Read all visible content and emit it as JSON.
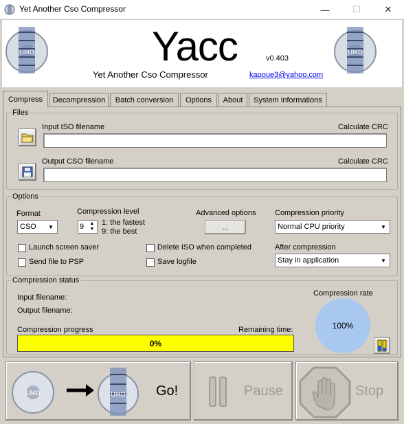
{
  "window": {
    "title": "Yet Another Cso Compressor"
  },
  "header": {
    "title": "Yacc",
    "version": "v0.403",
    "subtitle": "Yet Another Cso Compressor",
    "email": "kapoue3@yahoo.com",
    "logo_text": "UMD"
  },
  "tabs": [
    {
      "label": "Compress",
      "active": true
    },
    {
      "label": "Decompression"
    },
    {
      "label": "Batch conversion"
    },
    {
      "label": "Options"
    },
    {
      "label": "About"
    },
    {
      "label": "System informations"
    }
  ],
  "files": {
    "legend": "Files",
    "input_label": "Input ISO filename",
    "input_crc": "Calculate CRC",
    "input_value": "",
    "output_label": "Output CSO filename",
    "output_crc": "Calculate CRC",
    "output_value": ""
  },
  "options": {
    "legend": "Options",
    "format_label": "Format",
    "format_value": "CSO",
    "level_label": "Compression level",
    "level_value": "9",
    "level_hint1": "1: the fastest",
    "level_hint2": "9: the best",
    "advanced_label": "Advanced options",
    "advanced_button": "...",
    "priority_label": "Compression priority",
    "priority_value": "Normal CPU priority",
    "launch_screensaver": "Launch screen saver",
    "send_to_psp": "Send file to PSP",
    "delete_iso": "Delete ISO when completed",
    "save_logfile": "Save logfile",
    "after_label": "After compression",
    "after_value": "Stay in application"
  },
  "status": {
    "legend": "Compression status",
    "input_filename": "Input filename:",
    "output_filename": "Output filename:",
    "progress_label": "Compression progress",
    "remaining_label": "Remaining time:",
    "progress_value": "0%",
    "rate_label": "Compression rate",
    "rate_value": "100%"
  },
  "actions": {
    "go": "Go!",
    "pause": "Pause",
    "stop": "Stop"
  },
  "colors": {
    "progress_fill": "#ffff00",
    "rate_circle": "#a8c8f0",
    "disabled_text": "#a09c94"
  }
}
